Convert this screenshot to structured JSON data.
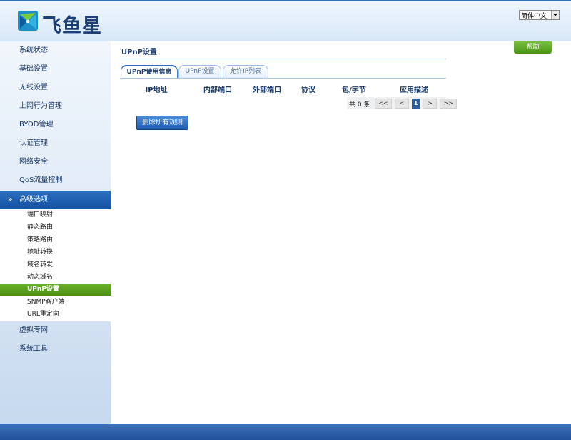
{
  "header": {
    "brand": "飞鱼星",
    "language": "简体中文",
    "colors": {
      "accent": "#1b3e74"
    }
  },
  "sidebar": {
    "items": [
      {
        "label": "系统状态"
      },
      {
        "label": "基础设置"
      },
      {
        "label": "无线设置"
      },
      {
        "label": "上网行为管理"
      },
      {
        "label": "BYOD管理"
      },
      {
        "label": "认证管理"
      },
      {
        "label": "网络安全"
      },
      {
        "label": "QoS流量控制"
      },
      {
        "label": "高级选项",
        "expanded": true
      },
      {
        "label": "虚拟专网"
      },
      {
        "label": "系统工具"
      }
    ],
    "subitems": [
      {
        "label": "端口映射"
      },
      {
        "label": "静态路由"
      },
      {
        "label": "策略路由"
      },
      {
        "label": "地址转换"
      },
      {
        "label": "域名转发"
      },
      {
        "label": "动态域名"
      },
      {
        "label": "UPnP设置",
        "active": true
      },
      {
        "label": "SNMP客户端"
      },
      {
        "label": "URL重定向"
      }
    ]
  },
  "main": {
    "title": "UPnP设置",
    "help_label": "帮助",
    "tabs": [
      {
        "label": "UPnP使用信息",
        "active": true
      },
      {
        "label": "UPnP设置"
      },
      {
        "label": "允许IP列表"
      }
    ],
    "table": {
      "columns": [
        "IP地址",
        "内部端口",
        "外部端口",
        "协议",
        "包/字节",
        "应用描述"
      ],
      "rows": []
    },
    "pager": {
      "count_text": "共 0 条",
      "first": "<<",
      "prev": "<",
      "current": "1",
      "next": ">",
      "last": ">>"
    },
    "delete_all_label": "删除所有规则"
  }
}
